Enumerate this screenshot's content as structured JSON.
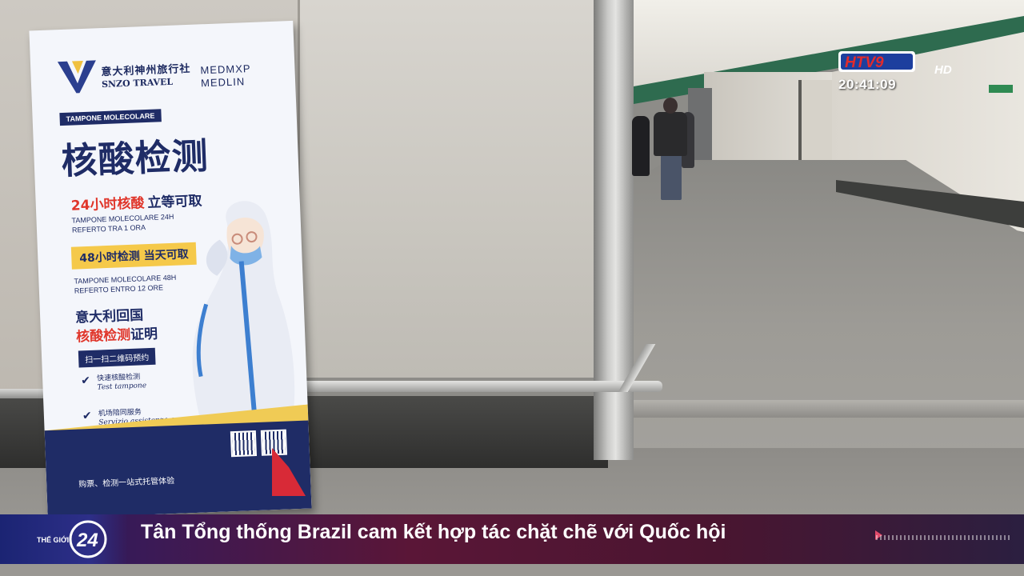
{
  "channel": {
    "logo_text": "HTV9",
    "hd_label": "HD",
    "clock": "20:41:09",
    "colors": {
      "red": "#e32b2b",
      "blue": "#1d3f9e"
    }
  },
  "ticker": {
    "program_label": "THẾ GIỚI",
    "program_number": "24",
    "headline": "Tân Tổng thống Brazil cam kết hợp tác chặt chẽ với Quốc hội",
    "icon": "play-arrow-icon"
  },
  "sign": {
    "agency_cn": "意大利神州旅行社",
    "agency_en": "SNZO TRAVEL",
    "partner_line1": "MEDMXP",
    "partner_line2": "MEDLIN",
    "tag": "TAMPONE MOLECOLARE",
    "headline": "核酸检测",
    "offer_24h_red": "24小时核酸",
    "offer_24h_blue": "立等可取",
    "offer_24h_it_1": "TAMPONE MOLECOLARE 24H",
    "offer_24h_it_2": "REFERTO TRA 1 ORA",
    "offer_48h": "48小时检测 当天可取",
    "offer_48h_it_1": "TAMPONE MOLECOLARE 48H",
    "offer_48h_it_2": "REFERTO ENTRO 12 ORE",
    "return_line": "意大利回国",
    "cert_red": "核酸检测",
    "cert_blue": "证明",
    "scan_label": "扫一扫二维码预约",
    "item1_cn": "快速核酸检测",
    "item1_it": "Test tampone",
    "item2_cn": "机场陪同服务",
    "item2_it": "Servizio assistenza aeroporto",
    "footer": "购票、检测一站式托管体验",
    "colors": {
      "navy": "#1f2c66",
      "red": "#e0362b",
      "yellow": "#f5c94a"
    }
  }
}
